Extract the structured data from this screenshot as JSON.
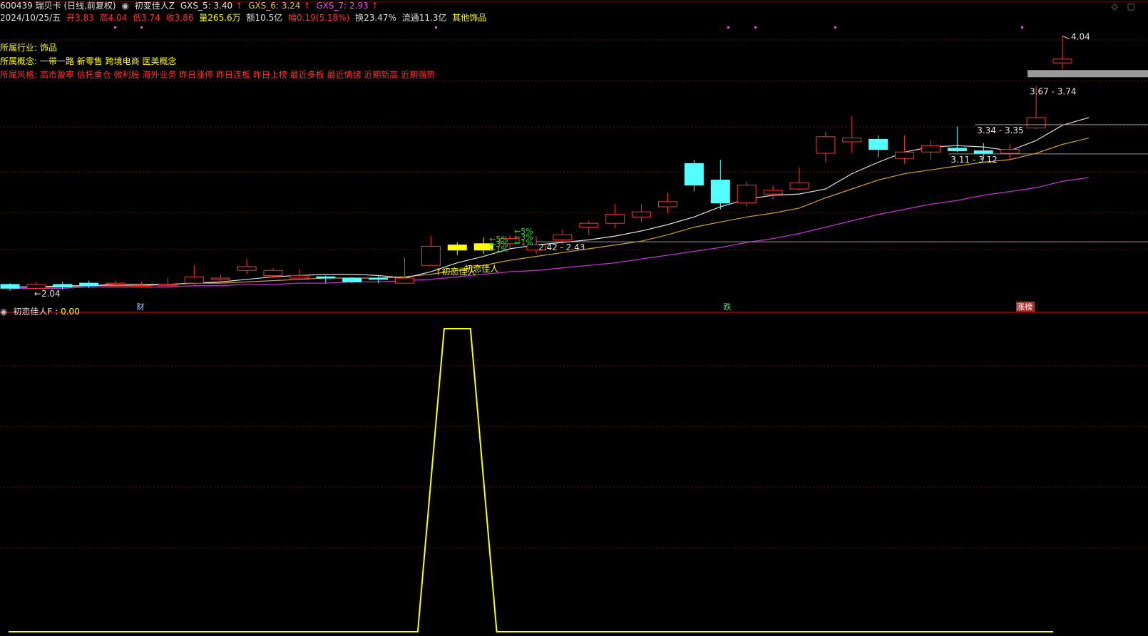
{
  "header": {
    "code_name": "600439 瑞贝卡 (日线,前复权)",
    "indicator_name": "初变佳人Z",
    "gxs5": "GXS_5: 3.40",
    "gxs6": "GXS_6: 3.24",
    "gxs7": "GXS_7: 2.93",
    "arrow": "↑",
    "date": "2024/10/25/五",
    "open": "开3.83",
    "high": "高4.04",
    "low": "低3.74",
    "close": "收3.86",
    "volume": "量265.6万",
    "amount": "额10.5亿",
    "amplitude": "幅0.19(5.18%)",
    "turnover": "换23.47%",
    "float_cap": "流通11.3亿",
    "sector_tag": "其他饰品"
  },
  "industry": {
    "label": "所属行业:",
    "value": "饰品"
  },
  "concept": {
    "label": "所属概念:",
    "value": "一带一路 新零售 跨境电商 医美概念"
  },
  "style": {
    "label": "所属风格:",
    "value": "高市盈率 信托重仓 微利股 海外业务 昨日涨停 昨日连板 昨日上榜 最近多板 最近情绪 近期新高 近期强势"
  },
  "colors": {
    "up": "#ff3232",
    "down": "#54ffff",
    "signal": "#ffff00",
    "ma5": "#e0e0e0",
    "ma6": "#d4a020",
    "ma7": "#c030d0",
    "grid": "#6a1010"
  },
  "chart_data": [
    {
      "type": "candlestick",
      "x": [
        1,
        2,
        3,
        4,
        5,
        6,
        7,
        8,
        9,
        10,
        11,
        12,
        13,
        14,
        15,
        16,
        17,
        18,
        19,
        20,
        21,
        22,
        23,
        24,
        25,
        26,
        27,
        28,
        29,
        30,
        31,
        32,
        33,
        34,
        35,
        36,
        37,
        38,
        39,
        40
      ],
      "open": [
        2.09,
        2.06,
        2.09,
        2.1,
        2.1,
        2.08,
        2.08,
        2.1,
        2.13,
        2.2,
        2.16,
        2.14,
        2.15,
        2.14,
        2.14,
        2.1,
        2.24,
        2.4,
        2.36,
        2.41,
        2.36,
        2.44,
        2.54,
        2.57,
        2.62,
        2.7,
        3.04,
        2.91,
        2.73,
        2.8,
        2.84,
        3.12,
        3.21,
        3.23,
        3.08,
        3.13,
        3.16,
        3.14,
        3.12,
        3.32
      ],
      "close": [
        2.06,
        2.09,
        2.07,
        2.08,
        2.1,
        2.08,
        2.09,
        2.15,
        2.14,
        2.23,
        2.2,
        2.16,
        2.14,
        2.11,
        2.13,
        2.14,
        2.39,
        2.36,
        2.41,
        2.45,
        2.4,
        2.48,
        2.57,
        2.64,
        2.66,
        2.74,
        2.87,
        2.73,
        2.87,
        2.83,
        2.89,
        3.25,
        3.24,
        3.15,
        3.13,
        3.18,
        3.14,
        3.12,
        3.15,
        3.4
      ],
      "high": [
        2.1,
        2.11,
        2.11,
        2.12,
        2.12,
        2.11,
        2.14,
        2.24,
        2.17,
        2.29,
        2.22,
        2.21,
        2.16,
        2.15,
        2.16,
        2.3,
        2.47,
        2.42,
        2.46,
        2.48,
        2.47,
        2.52,
        2.59,
        2.72,
        2.72,
        2.81,
        3.07,
        3.07,
        2.9,
        2.87,
        3.01,
        3.29,
        3.41,
        3.26,
        3.26,
        3.22,
        3.33,
        3.2,
        3.19,
        3.65
      ],
      "low": [
        2.04,
        2.05,
        2.05,
        2.06,
        2.07,
        2.07,
        2.07,
        2.09,
        2.1,
        2.17,
        2.14,
        2.13,
        2.1,
        2.1,
        2.1,
        2.1,
        2.24,
        2.32,
        2.33,
        2.37,
        2.33,
        2.4,
        2.48,
        2.53,
        2.58,
        2.65,
        2.82,
        2.68,
        2.7,
        2.76,
        2.83,
        3.05,
        3.12,
        3.09,
        3.04,
        3.07,
        3.13,
        3.07,
        3.07,
        3.31
      ],
      "last_candle": {
        "open": 3.83,
        "high": 4.04,
        "low": 3.74,
        "close": 3.86
      },
      "ma5": [
        2.07,
        2.07,
        2.08,
        2.08,
        2.09,
        2.09,
        2.09,
        2.1,
        2.11,
        2.13,
        2.15,
        2.16,
        2.17,
        2.17,
        2.16,
        2.14,
        2.19,
        2.26,
        2.31,
        2.37,
        2.4,
        2.42,
        2.44,
        2.47,
        2.51,
        2.56,
        2.62,
        2.7,
        2.76,
        2.79,
        2.8,
        2.84,
        2.96,
        3.05,
        3.13,
        3.17,
        3.18,
        3.17,
        3.14,
        3.22,
        3.34,
        3.4
      ],
      "ma6": [
        2.07,
        2.07,
        2.07,
        2.08,
        2.08,
        2.08,
        2.09,
        2.1,
        2.1,
        2.11,
        2.12,
        2.13,
        2.14,
        2.14,
        2.14,
        2.15,
        2.17,
        2.2,
        2.24,
        2.28,
        2.31,
        2.34,
        2.37,
        2.4,
        2.43,
        2.48,
        2.54,
        2.58,
        2.62,
        2.65,
        2.69,
        2.77,
        2.84,
        2.91,
        2.96,
        2.99,
        3.02,
        3.05,
        3.07,
        3.12,
        3.19,
        3.24
      ],
      "ma7": [
        2.06,
        2.06,
        2.06,
        2.07,
        2.07,
        2.07,
        2.07,
        2.08,
        2.08,
        2.09,
        2.09,
        2.1,
        2.1,
        2.11,
        2.11,
        2.12,
        2.13,
        2.15,
        2.17,
        2.19,
        2.2,
        2.22,
        2.24,
        2.26,
        2.29,
        2.32,
        2.35,
        2.38,
        2.42,
        2.45,
        2.49,
        2.54,
        2.59,
        2.64,
        2.68,
        2.72,
        2.75,
        2.79,
        2.82,
        2.85,
        2.9,
        2.93
      ],
      "annotations": {
        "low_label": "←2.04",
        "high_label": "4.04",
        "bands": [
          {
            "label": "3.67 - 3.74",
            "low": 3.67,
            "high": 3.74
          },
          {
            "label": "3.34 - 3.35",
            "low": 3.34,
            "high": 3.35
          },
          {
            "label": "3.11 - 3.12",
            "low": 3.11,
            "high": 3.12
          },
          {
            "label": "2.42 - 2.43",
            "low": 2.42,
            "high": 2.43
          }
        ],
        "pct_labels": [
          "←5%",
          "←3%",
          "←1%",
          "←5%",
          "←3%",
          "←1%"
        ],
        "signal_labels": [
          "初恋佳人",
          "初恋佳人"
        ],
        "bottom_marks": [
          "财",
          "跌",
          "涨榜"
        ]
      },
      "ylim": [
        2.0,
        4.1
      ]
    },
    {
      "type": "line",
      "title": "初恋佳人F",
      "value_label": ": 0.00",
      "x": [
        0,
        16.5,
        17.5,
        18.5,
        19.5,
        40
      ],
      "values": [
        0,
        0,
        1,
        1,
        0,
        0
      ],
      "ylim": [
        0,
        1
      ]
    }
  ]
}
